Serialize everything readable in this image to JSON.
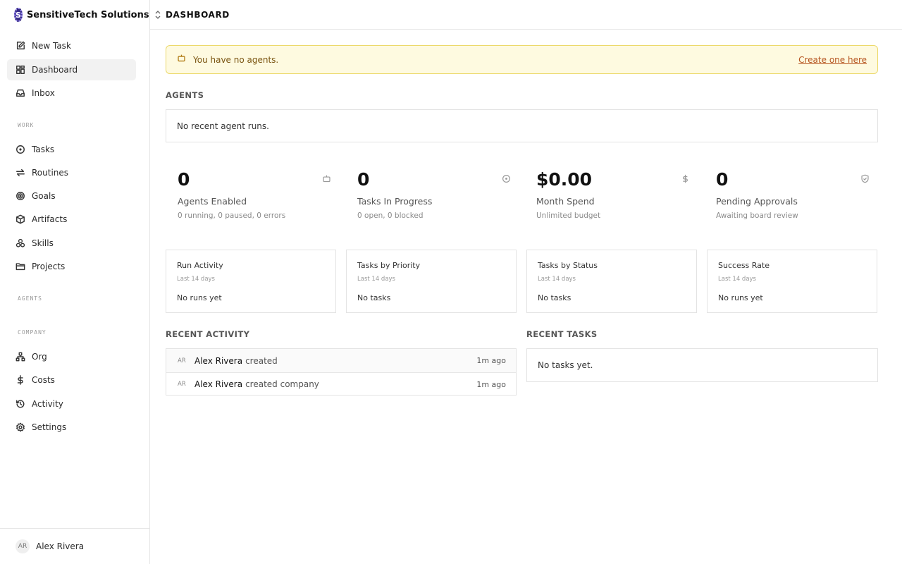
{
  "workspace": {
    "name": "SensitiveTech Solutions",
    "logo_letter": "S"
  },
  "sidebar": {
    "primary": [
      {
        "label": "New Task",
        "icon": "edit-icon"
      },
      {
        "label": "Dashboard",
        "icon": "grid-icon",
        "active": true
      },
      {
        "label": "Inbox",
        "icon": "inbox-icon"
      }
    ],
    "sections": {
      "work": "WORK",
      "agents": "AGENTS",
      "company": "COMPANY"
    },
    "work_items": [
      {
        "label": "Tasks",
        "icon": "circle-dot-icon"
      },
      {
        "label": "Routines",
        "icon": "repeat-icon"
      },
      {
        "label": "Goals",
        "icon": "target-icon"
      },
      {
        "label": "Artifacts",
        "icon": "box-icon"
      },
      {
        "label": "Skills",
        "icon": "shapes-icon"
      },
      {
        "label": "Projects",
        "icon": "folder-icon"
      }
    ],
    "company_items": [
      {
        "label": "Org",
        "icon": "org-chart-icon"
      },
      {
        "label": "Costs",
        "icon": "dollar-icon"
      },
      {
        "label": "Activity",
        "icon": "history-icon"
      },
      {
        "label": "Settings",
        "icon": "gear-icon"
      }
    ],
    "user": {
      "initials": "AR",
      "name": "Alex Rivera"
    }
  },
  "header": {
    "title": "DASHBOARD"
  },
  "alert": {
    "text": "You have no agents.",
    "link": "Create one here"
  },
  "agents": {
    "heading": "AGENTS",
    "empty": "No recent agent runs."
  },
  "metrics": [
    {
      "value": "0",
      "label": "Agents Enabled",
      "sub": "0 running, 0 paused, 0 errors",
      "icon": "bot-icon"
    },
    {
      "value": "0",
      "label": "Tasks In Progress",
      "sub": "0 open, 0 blocked",
      "icon": "circle-dot-icon"
    },
    {
      "value": "$0.00",
      "label": "Month Spend",
      "sub": "Unlimited budget",
      "icon": "dollar-icon"
    },
    {
      "value": "0",
      "label": "Pending Approvals",
      "sub": "Awaiting board review",
      "icon": "shield-check-icon"
    }
  ],
  "cards": [
    {
      "title": "Run Activity",
      "sub": "Last 14 days",
      "empty": "No runs yet"
    },
    {
      "title": "Tasks by Priority",
      "sub": "Last 14 days",
      "empty": "No tasks"
    },
    {
      "title": "Tasks by Status",
      "sub": "Last 14 days",
      "empty": "No tasks"
    },
    {
      "title": "Success Rate",
      "sub": "Last 14 days",
      "empty": "No runs yet"
    }
  ],
  "recent_activity": {
    "heading": "RECENT ACTIVITY",
    "rows": [
      {
        "initials": "AR",
        "actor": "Alex Rivera",
        "verb": "created",
        "time": "1m ago"
      },
      {
        "initials": "AR",
        "actor": "Alex Rivera",
        "verb": "created company",
        "time": "1m ago"
      }
    ]
  },
  "recent_tasks": {
    "heading": "RECENT TASKS",
    "empty": "No tasks yet."
  }
}
